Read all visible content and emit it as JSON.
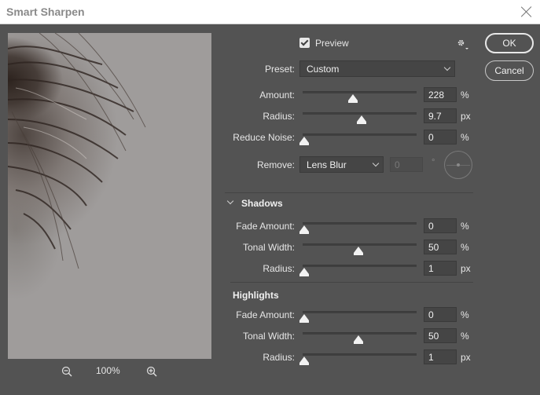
{
  "window": {
    "title": "Smart Sharpen"
  },
  "preview_pane": {
    "zoom_level": "100%"
  },
  "preview_toggle": {
    "label": "Preview",
    "checked": true
  },
  "buttons": {
    "ok": "OK",
    "cancel": "Cancel"
  },
  "preset": {
    "label": "Preset:",
    "value": "Custom"
  },
  "sharpen": {
    "amount": {
      "label": "Amount:",
      "value": "228",
      "unit": "%",
      "level": 0.45
    },
    "radius": {
      "label": "Radius:",
      "value": "9.7",
      "unit": "px",
      "level": 0.53
    },
    "reduce_noise": {
      "label": "Reduce Noise:",
      "value": "0",
      "unit": "%",
      "level": 0.0
    }
  },
  "remove": {
    "label": "Remove:",
    "value": "Lens Blur",
    "angle": "0",
    "angle_unit": "°"
  },
  "shadows": {
    "title": "Shadows",
    "fade_amount": {
      "label": "Fade Amount:",
      "value": "0",
      "unit": "%",
      "level": 0.0
    },
    "tonal_width": {
      "label": "Tonal Width:",
      "value": "50",
      "unit": "%",
      "level": 0.5
    },
    "radius": {
      "label": "Radius:",
      "value": "1",
      "unit": "px",
      "level": 0.0
    }
  },
  "highlights": {
    "title": "Highlights",
    "fade_amount": {
      "label": "Fade Amount:",
      "value": "0",
      "unit": "%",
      "level": 0.0
    },
    "tonal_width": {
      "label": "Tonal Width:",
      "value": "50",
      "unit": "%",
      "level": 0.5
    },
    "radius": {
      "label": "Radius:",
      "value": "1",
      "unit": "px",
      "level": 0.0
    }
  },
  "icons": {
    "close": "close-icon",
    "settings": "gear-icon",
    "zoom_out": "zoom-out-icon",
    "zoom_in": "zoom-in-icon"
  }
}
